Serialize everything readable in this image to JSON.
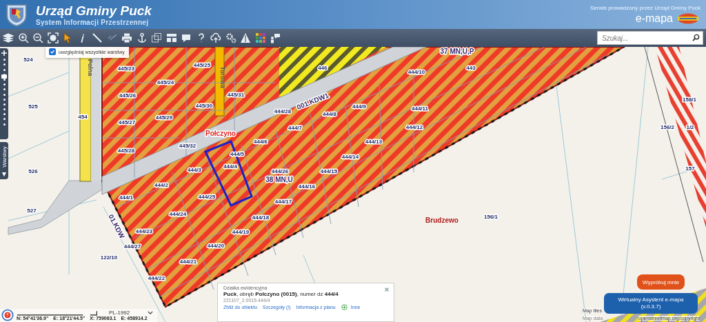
{
  "header": {
    "title": "Urząd Gminy Puck",
    "subtitle": "System Informacji Przestrzennej",
    "service_note": "Serwis prowadzony przez Urząd Gminy Puck",
    "brand": "e-mapa"
  },
  "search": {
    "placeholder": "Szukaj..."
  },
  "layer_filter": {
    "label": "uwzględniaj wszystkie warstwy",
    "checked": true
  },
  "side_panel": {
    "label": "Warstwy"
  },
  "zoom_slider": {
    "level": 0.7
  },
  "map": {
    "labels": [
      {
        "text": "524",
        "kind": "parcel"
      },
      {
        "text": "525",
        "kind": "parcel"
      },
      {
        "text": "526",
        "kind": "parcel"
      },
      {
        "text": "527",
        "kind": "parcel"
      },
      {
        "text": "454",
        "kind": "parcel"
      },
      {
        "text": "Polna",
        "kind": "street"
      },
      {
        "text": "445/23",
        "kind": "parcel"
      },
      {
        "text": "445/26",
        "kind": "parcel"
      },
      {
        "text": "445/27",
        "kind": "parcel"
      },
      {
        "text": "445/28",
        "kind": "parcel"
      },
      {
        "text": "445/24",
        "kind": "parcel"
      },
      {
        "text": "445/25",
        "kind": "parcel"
      },
      {
        "text": "445/29",
        "kind": "parcel"
      },
      {
        "text": "445/30",
        "kind": "parcel"
      },
      {
        "text": "445/31",
        "kind": "parcel"
      },
      {
        "text": "Torowa",
        "kind": "street"
      },
      {
        "text": "446",
        "kind": "parcel"
      },
      {
        "text": "37 MN,U,P",
        "kind": "zone"
      },
      {
        "text": "444/10",
        "kind": "parcel"
      },
      {
        "text": "443",
        "kind": "parcel"
      },
      {
        "text": "001.KDW1",
        "kind": "zone"
      },
      {
        "text": "444/28",
        "kind": "parcel"
      },
      {
        "text": "444/9",
        "kind": "parcel"
      },
      {
        "text": "444/8",
        "kind": "parcel"
      },
      {
        "text": "444/11",
        "kind": "parcel"
      },
      {
        "text": "444/7",
        "kind": "parcel"
      },
      {
        "text": "444/12",
        "kind": "parcel"
      },
      {
        "text": "444/6",
        "kind": "parcel"
      },
      {
        "text": "444/13",
        "kind": "parcel"
      },
      {
        "text": "444/5",
        "kind": "parcel"
      },
      {
        "text": "444/14",
        "kind": "parcel"
      },
      {
        "text": "445/32",
        "kind": "parcel"
      },
      {
        "text": "Połczyno",
        "kind": "place"
      },
      {
        "text": "444/3",
        "kind": "parcel"
      },
      {
        "text": "444/4",
        "kind": "parcel"
      },
      {
        "text": "444/26",
        "kind": "parcel"
      },
      {
        "text": "38 MN,U",
        "kind": "zone"
      },
      {
        "text": "444/15",
        "kind": "parcel"
      },
      {
        "text": "444/2",
        "kind": "parcel"
      },
      {
        "text": "444/16",
        "kind": "parcel"
      },
      {
        "text": "444/1",
        "kind": "parcel"
      },
      {
        "text": "444/25",
        "kind": "parcel"
      },
      {
        "text": "444/17",
        "kind": "parcel"
      },
      {
        "text": "444/24",
        "kind": "parcel"
      },
      {
        "text": "444/18",
        "kind": "parcel"
      },
      {
        "text": "444/23",
        "kind": "parcel"
      },
      {
        "text": "444/19",
        "kind": "parcel"
      },
      {
        "text": "01.KDW",
        "kind": "zone"
      },
      {
        "text": "444/27",
        "kind": "parcel"
      },
      {
        "text": "444/20",
        "kind": "parcel"
      },
      {
        "text": "122/10",
        "kind": "parcel"
      },
      {
        "text": "444/21",
        "kind": "parcel"
      },
      {
        "text": "444/22",
        "kind": "parcel"
      },
      {
        "text": "Brudzewo",
        "kind": "village"
      },
      {
        "text": "156/1",
        "kind": "parcel"
      },
      {
        "text": "158/1",
        "kind": "parcel"
      },
      {
        "text": "156/2",
        "kind": "parcel"
      },
      {
        "text": "1/2",
        "kind": "parcel"
      },
      {
        "text": "157",
        "kind": "parcel"
      }
    ]
  },
  "info_popup": {
    "heading": "Działka ewidencyjna",
    "description": "**Puck**, obręb **Połczyno (0015)**, numer dz **444/4**",
    "identifier": "221107_2.0015.444/4",
    "links": [
      "Zbliż do obiektu",
      "Szczegóły (!)",
      "Informacja z planu",
      "Inne"
    ]
  },
  "coordinates": {
    "system": "PL-1992",
    "readouts": [
      "N: 54°41'36.9\"",
      "E: 18°21'44.5\"",
      "X: 759063.1",
      "E: 458914.2"
    ]
  },
  "assistant": {
    "try_button": "Wypróbuj mnie",
    "title": "Wirtualny Asystent e-mapa",
    "version": "(v.0.3.7)"
  },
  "attribution": [
    "Map tiles",
    "Map data",
    "openstreetmap.org/copyright"
  ]
}
